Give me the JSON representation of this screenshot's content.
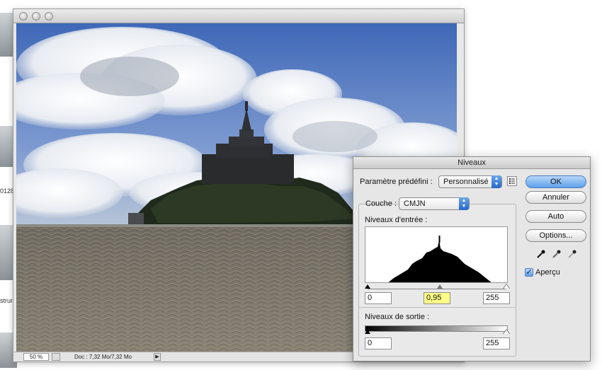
{
  "background": {
    "fragments": [
      "0128",
      "strun"
    ]
  },
  "document": {
    "status": {
      "zoom": "50 %",
      "doc_info": "Doc : 7,32 Mo/7,32 Mo"
    }
  },
  "levels_dialog": {
    "title": "Niveaux",
    "preset_label": "Paramètre prédéfini :",
    "preset_value": "Personnalisé",
    "channel_label": "Couche :",
    "channel_value": "CMJN",
    "input_levels_label": "Niveaux d'entrée :",
    "input_black": "0",
    "input_gamma": "0,95",
    "input_white": "255",
    "output_levels_label": "Niveaux de sortie :",
    "output_black": "0",
    "output_white": "255",
    "buttons": {
      "ok": "OK",
      "cancel": "Annuler",
      "auto": "Auto",
      "options": "Options..."
    },
    "preview_label": "Aperçu",
    "preview_checked": true,
    "accent_color": "#5fa0ea",
    "highlight_color": "#ffff88"
  }
}
